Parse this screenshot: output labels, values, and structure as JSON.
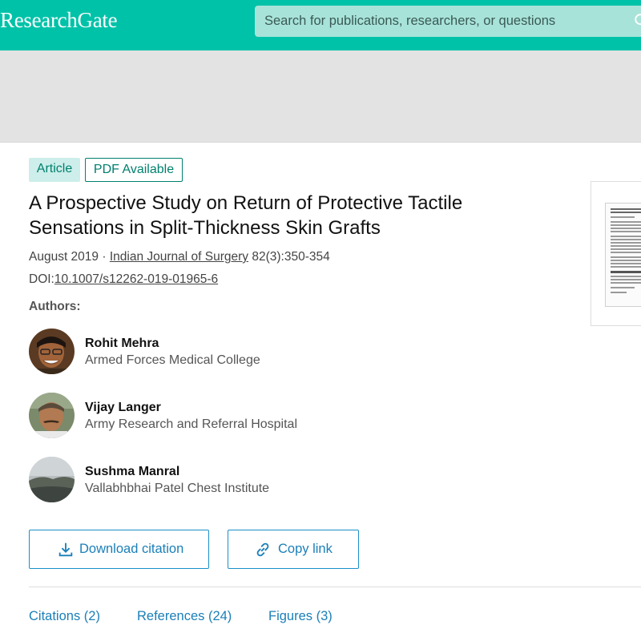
{
  "header": {
    "logo": "ResearchGate",
    "search_placeholder": "Search for publications, researchers, or questions",
    "brand_color": "#00c2a8"
  },
  "publication": {
    "type_badge": "Article",
    "pdf_badge": "PDF Available",
    "title": "A Prospective Study on Return of Protective Tactile Sensations in Split-Thickness Skin Grafts",
    "date": "August 2019",
    "separator": "·",
    "journal": "Indian Journal of Surgery",
    "volume_pages": "82(3):350-354",
    "doi_label": "DOI:",
    "doi": "10.1007/s12262-019-01965-6"
  },
  "authors": {
    "label": "Authors:",
    "list": [
      {
        "name": "Rohit Mehra",
        "institution": "Armed Forces Medical College"
      },
      {
        "name": "Vijay Langer",
        "institution": "Army Research and Referral Hospital"
      },
      {
        "name": "Sushma Manral",
        "institution": "Vallabhbhai Patel Chest Institute"
      }
    ]
  },
  "actions": {
    "download_citation": "Download citation",
    "copy_link": "Copy link"
  },
  "tabs": [
    {
      "label": "Citations (2)"
    },
    {
      "label": "References (24)"
    },
    {
      "label": "Figures (3)"
    }
  ],
  "colors": {
    "accent_teal": "#00806e",
    "link_blue": "#1a7fb8"
  }
}
